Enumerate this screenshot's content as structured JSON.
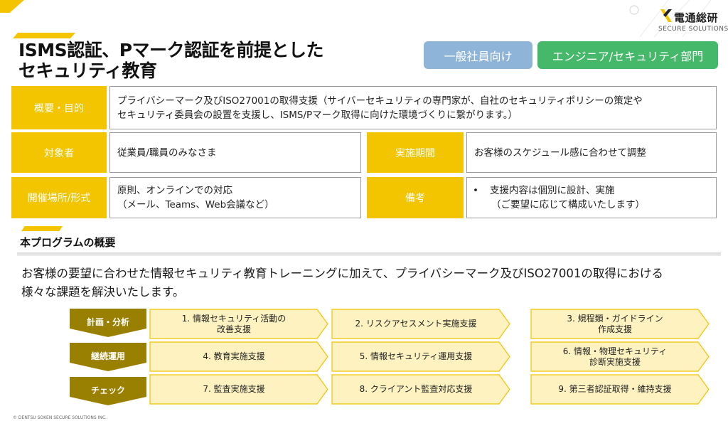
{
  "logo": {
    "name": "電通総研",
    "tagline": "SECURE SOLUTIONS"
  },
  "title": {
    "line1": "ISMS認証、Pマーク認証を前提とした",
    "line2": "セキュリティ教育"
  },
  "audience": {
    "general": "一般社員向け",
    "engineer": "エンジニア/セキュリティ部門"
  },
  "info": {
    "purpose": {
      "label": "概要・目的",
      "line1": "プライバシーマーク及びISO27001の取得支援（サイバーセキュリティの専門家が、自社のセキュリティポリシーの策定や",
      "line2": "セキュリティ委員会の設置を支援し、ISMS/Pマーク取得に向けた環境づくりに繋がります。）"
    },
    "target": {
      "label": "対象者",
      "value": "従業員/職員のみなさま"
    },
    "period": {
      "label": "実施期間",
      "value": "お客様のスケジュール感に合わせて調整"
    },
    "venue": {
      "label": "開催場所/形式",
      "line1": "原則、オンラインでの対応",
      "line2": "（メール、Teams、Web会議など）"
    },
    "notes": {
      "label": "備考",
      "bullet": "•",
      "line1": "支援内容は個別に設計、実施",
      "line2": "（ご要望に応じて構成いたします）"
    }
  },
  "program": {
    "heading": "本プログラムの概要",
    "intro_line1": "お客様の要望に合わせた情報セキュリティ教育トレーニングに加えて、プライバシーマーク及びISO27001の取得における",
    "intro_line2": "様々な課題を解決いたします。"
  },
  "phases": [
    {
      "label": "計画・分析",
      "steps": [
        {
          "line1": "1. 情報セキュリティ活動の",
          "line2": "改善支援"
        },
        {
          "line1": "2. リスクアセスメント実施支援",
          "line2": ""
        },
        {
          "line1": "3. 規程類・ガイドライン",
          "line2": "作成支援"
        }
      ]
    },
    {
      "label": "継続運用",
      "steps": [
        {
          "line1": "4. 教育実施支援",
          "line2": ""
        },
        {
          "line1": "5. 情報セキュリティ運用支援",
          "line2": ""
        },
        {
          "line1": "6. 情報・物理セキュリティ",
          "line2": "診断実施支援"
        }
      ]
    },
    {
      "label": "チェック",
      "steps": [
        {
          "line1": "7. 監査実施支援",
          "line2": ""
        },
        {
          "line1": "8. クライアント監査対応支援",
          "line2": ""
        },
        {
          "line1": "9. 第三者認証取得・維持支援",
          "line2": ""
        }
      ]
    }
  ],
  "colors": {
    "accent_yellow": "#f2c500",
    "phase_olive": "#9a8000",
    "step_fill": "#fdf2c0",
    "step_border": "#f0c400",
    "general_blue": "#8eb4d8",
    "engineer_green": "#45b86a"
  },
  "footer": "© DENTSU SOKEN SECURE SOLUTIONS INC."
}
